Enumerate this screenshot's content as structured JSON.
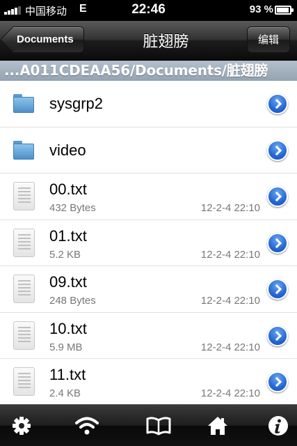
{
  "status_bar": {
    "carrier": "中国移动",
    "network": "E",
    "time": "22:46",
    "battery_percent": "93 %",
    "battery_level": 0.93
  },
  "nav": {
    "back_label": "Documents",
    "title": "脏翅膀",
    "edit_label": "编辑"
  },
  "path": "...A011CDEAA56/Documents/脏翅膀",
  "items": [
    {
      "type": "folder",
      "name": "sysgrp2"
    },
    {
      "type": "folder",
      "name": "video"
    },
    {
      "type": "file",
      "name": "00.txt",
      "size": "432 Bytes",
      "date": "12-2-4 22:10"
    },
    {
      "type": "file",
      "name": "01.txt",
      "size": "5.2 KB",
      "date": "12-2-4 22:10"
    },
    {
      "type": "file",
      "name": "09.txt",
      "size": "248 Bytes",
      "date": "12-2-4 22:10"
    },
    {
      "type": "file",
      "name": "10.txt",
      "size": "5.9 MB",
      "date": "12-2-4 22:10"
    },
    {
      "type": "file",
      "name": "11.txt",
      "size": "2.4 KB",
      "date": "12-2-4 22:10"
    }
  ],
  "toolbar": {
    "icons": [
      "gear-icon",
      "wifi-icon",
      "book-icon",
      "home-icon",
      "info-icon"
    ]
  },
  "colors": {
    "accent_blue": "#2468d6",
    "path_bar": "#a3b1bf"
  }
}
